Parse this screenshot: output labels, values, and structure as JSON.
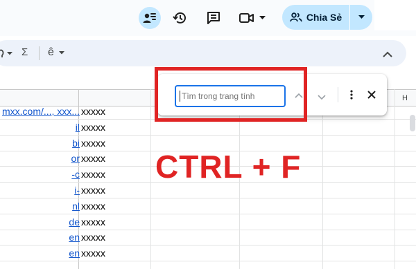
{
  "topbar": {
    "share_label": "Chia Sẻ"
  },
  "toolbar": {
    "sum_symbol": "Σ",
    "font_symbol": "ê"
  },
  "grid": {
    "column_header_h": "H",
    "colB_values": [
      "xxxxx",
      "xxxxx",
      "xxxxx",
      "xxxxx",
      "xxxxx",
      "xxxxx",
      "xxxxx",
      "xxxxx",
      "xxxxx",
      "xxxxx"
    ],
    "colA_fragments": [
      "mxx.com/..., xxx...",
      "il",
      "bi",
      "or",
      "-c",
      "i-",
      "nl",
      "de",
      "en",
      "en"
    ]
  },
  "find": {
    "placeholder": "Tìm trong trang tính"
  },
  "overlay": {
    "shortcut_text": "CTRL + F"
  },
  "colors": {
    "accent": "#1a73e8",
    "share_bg": "#c2e7ff",
    "highlight_red": "#e02424"
  }
}
